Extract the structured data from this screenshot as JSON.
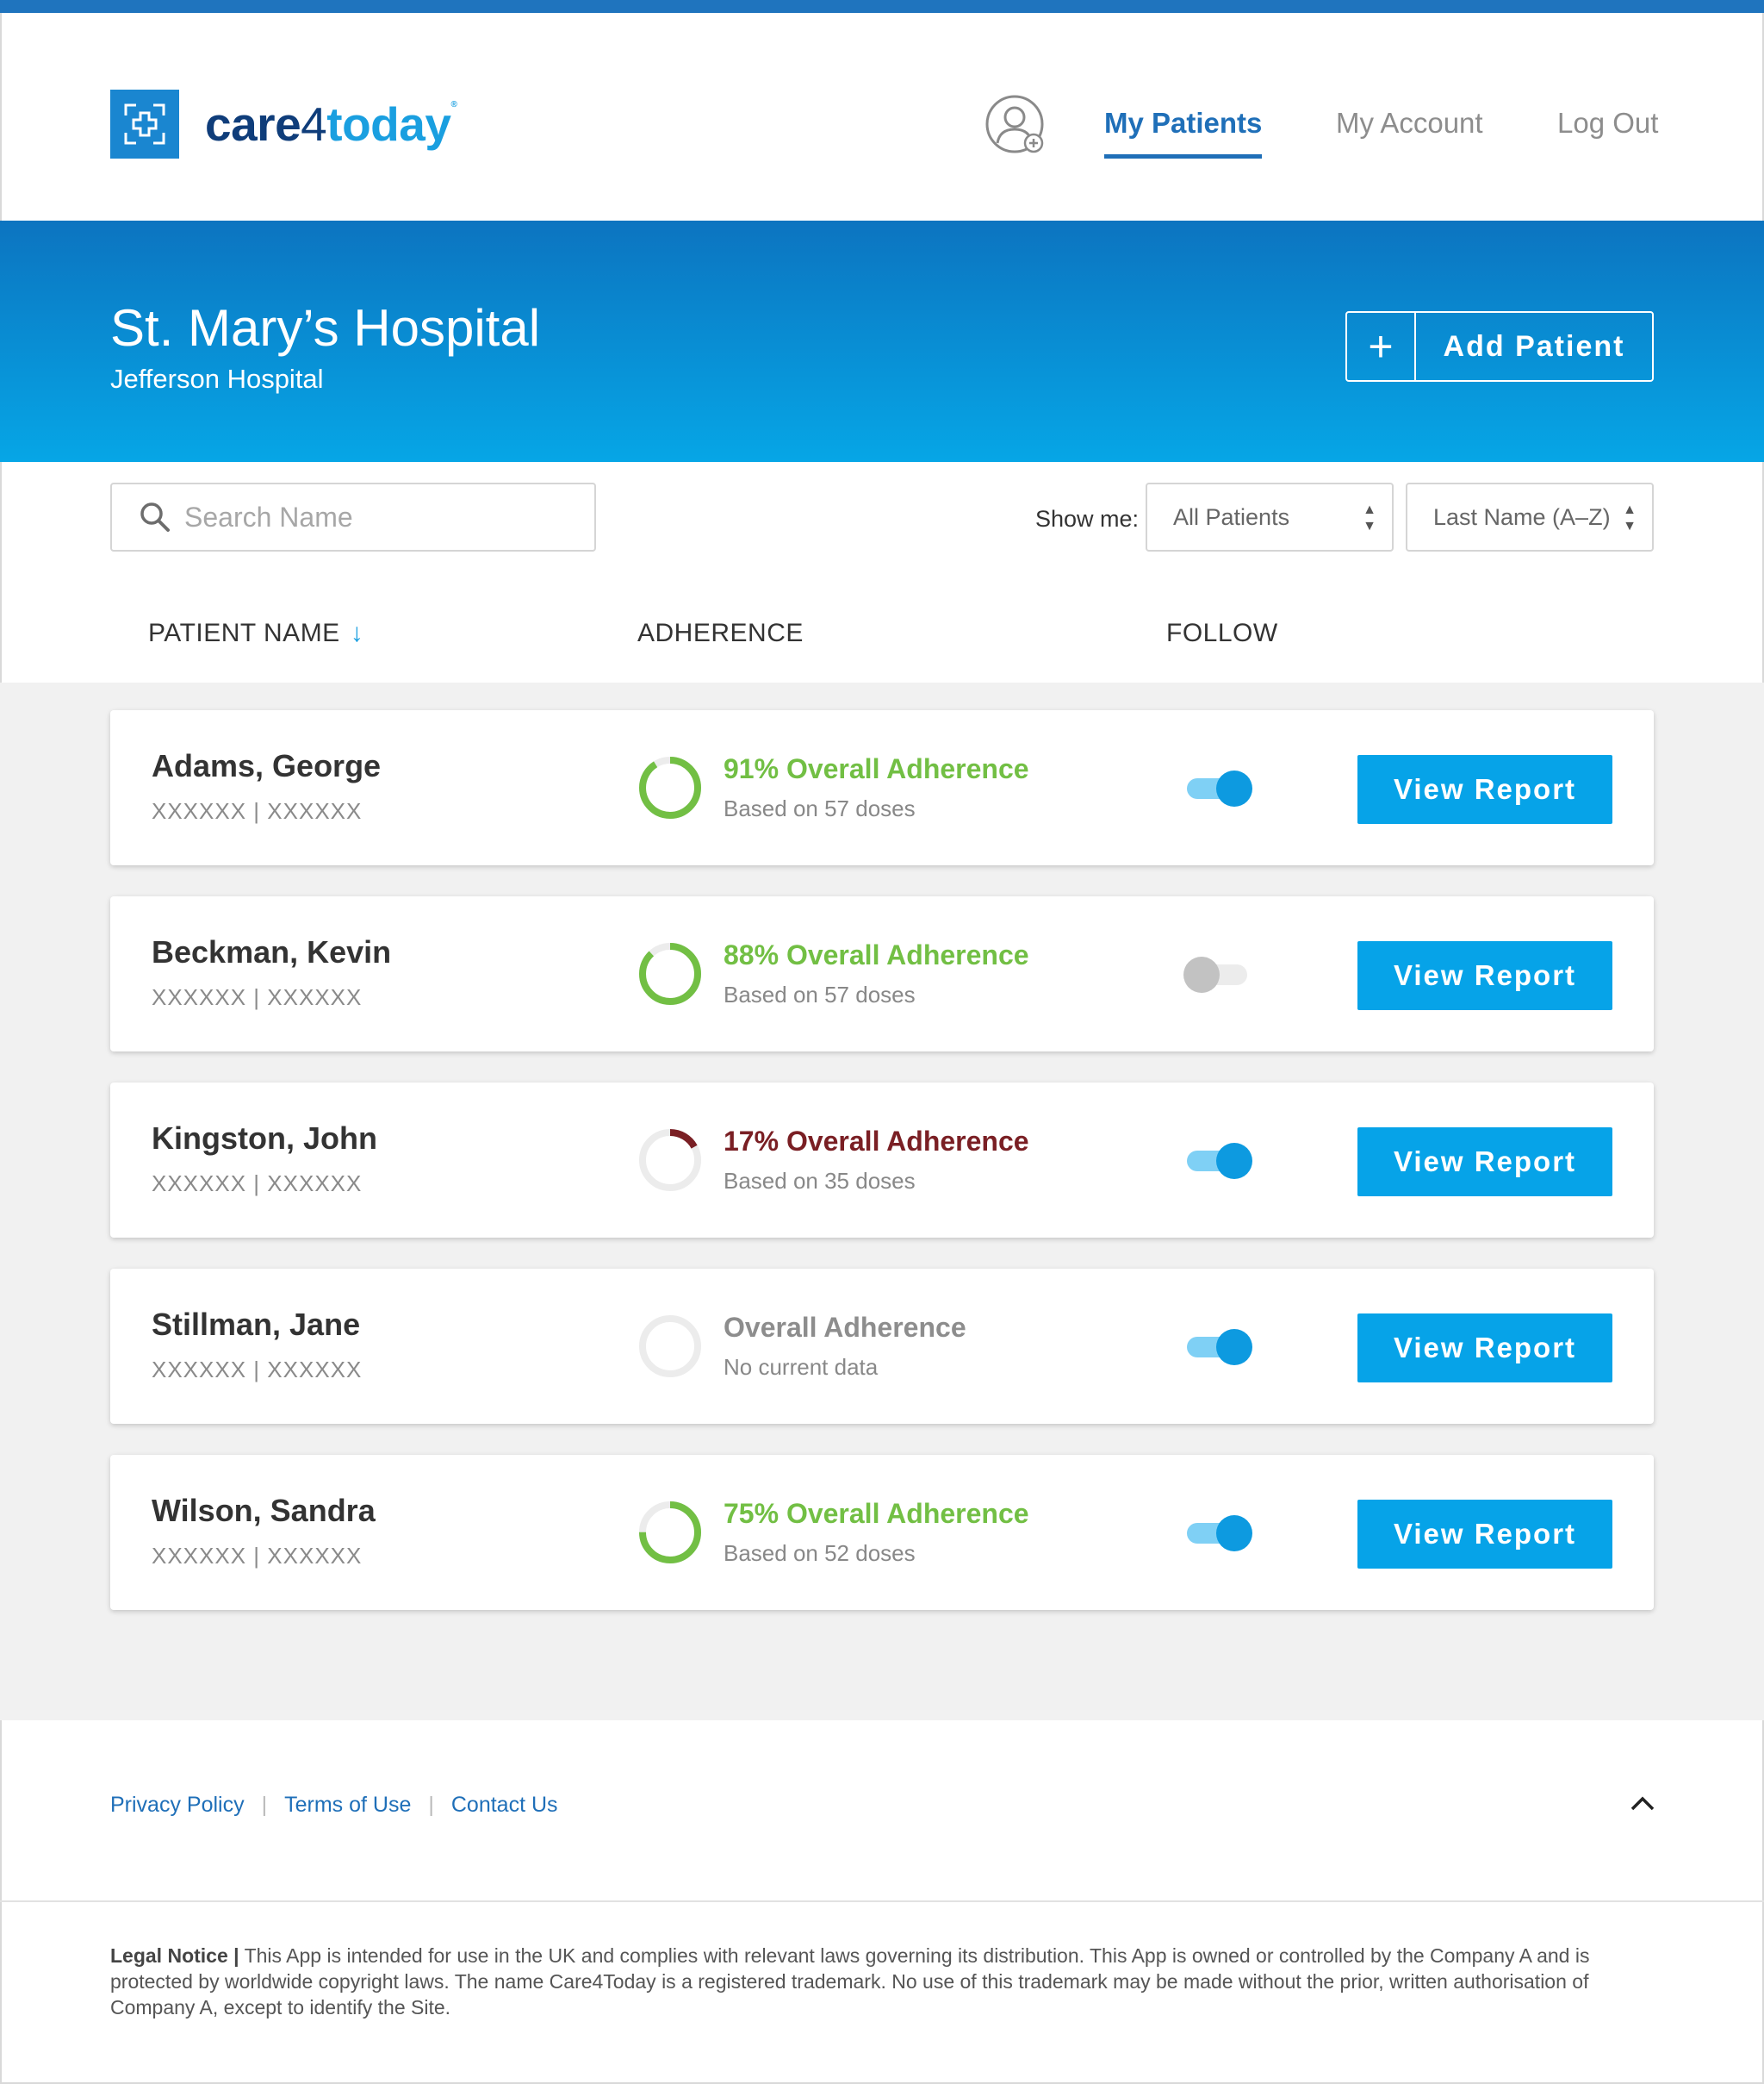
{
  "brand": {
    "care": "care",
    "four": "4",
    "today": "today",
    "reg": "®"
  },
  "nav": {
    "my_patients": "My Patients",
    "my_account": "My Account",
    "log_out": "Log Out"
  },
  "banner": {
    "hospital": "St. Mary’s Hospital",
    "sub_hospital": "Jefferson Hospital",
    "add_patient": "Add Patient",
    "add_icon": "+"
  },
  "controls": {
    "search_placeholder": "Search Name",
    "show_me": "Show me:",
    "filter_value": "All Patients",
    "sort_value": "Last Name (A–Z)"
  },
  "columns": {
    "name": "PATIENT NAME",
    "adherence": "ADHERENCE",
    "follow": "FOLLOW",
    "sort_icon": "↓"
  },
  "colors": {
    "good": "#72bf44",
    "bad": "#7a1f24",
    "none": "#8d8d8d",
    "accent": "#06a3e8"
  },
  "patients": [
    {
      "name": "Adams, George",
      "id1": "XXXXXX",
      "sep": "|",
      "id2": "XXXXXX",
      "adherence_pct": 91,
      "adherence_label": "91% Overall Adherence",
      "adherence_sub": "Based on 57 doses",
      "status": "good",
      "follow": true,
      "button": "View Report"
    },
    {
      "name": "Beckman, Kevin",
      "id1": "XXXXXX",
      "sep": "|",
      "id2": "XXXXXX",
      "adherence_pct": 88,
      "adherence_label": "88% Overall Adherence",
      "adherence_sub": "Based on 57 doses",
      "status": "good",
      "follow": false,
      "button": "View Report"
    },
    {
      "name": "Kingston, John",
      "id1": "XXXXXX",
      "sep": "|",
      "id2": "XXXXXX",
      "adherence_pct": 17,
      "adherence_label": "17% Overall Adherence",
      "adherence_sub": "Based on 35 doses",
      "status": "bad",
      "follow": true,
      "button": "View Report"
    },
    {
      "name": "Stillman, Jane",
      "id1": "XXXXXX",
      "sep": "|",
      "id2": "XXXXXX",
      "adherence_pct": 0,
      "adherence_label": "Overall Adherence",
      "adherence_sub": "No current data",
      "status": "none",
      "follow": true,
      "button": "View Report"
    },
    {
      "name": "Wilson, Sandra",
      "id1": "XXXXXX",
      "sep": "|",
      "id2": "XXXXXX",
      "adherence_pct": 75,
      "adherence_label": "75% Overall Adherence",
      "adherence_sub": "Based on 52 doses",
      "status": "good",
      "follow": true,
      "button": "View Report"
    }
  ],
  "footer": {
    "privacy": "Privacy Policy",
    "terms": "Terms of Use",
    "contact": "Contact Us",
    "sep": "|",
    "legal_title": "Legal Notice |",
    "legal_text": " This App is intended for use in the UK and complies with relevant laws governing its distribution. This App is owned or controlled by the Company A and is protected by worldwide copyright laws. The name Care4Today is a registered trademark. No use of this trademark may be made without the prior, written authorisation of Company A, except to identify the Site."
  }
}
